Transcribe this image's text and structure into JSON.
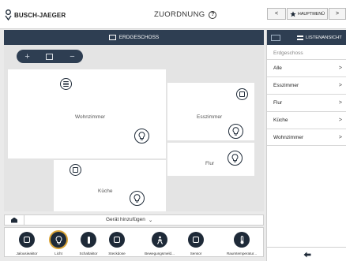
{
  "header": {
    "logo_text": "BUSCH-JAEGER",
    "title": "ZUORDNUNG",
    "help_symbol": "?",
    "nav_prev": "<",
    "nav_main": "HAUPTMENÜ",
    "nav_next": ">"
  },
  "floorplan": {
    "floor_name": "ERDGESCHOSS",
    "zoom_in": "+",
    "zoom_out": "−",
    "rooms": [
      {
        "name": "Wohnzimmer"
      },
      {
        "name": "Esszimmer"
      },
      {
        "name": "Flur"
      },
      {
        "name": "Küche"
      }
    ]
  },
  "right_panel": {
    "title": "LISTENANSICHT",
    "floor": "Erdgeschoss",
    "items": [
      {
        "label": "Alle",
        "chevron": ">"
      },
      {
        "label": "Esszimmer",
        "chevron": ">"
      },
      {
        "label": "Flur",
        "chevron": ">"
      },
      {
        "label": "Küche",
        "chevron": ">"
      },
      {
        "label": "Wohnzimmer",
        "chevron": ">"
      }
    ],
    "back_symbol": "🡸"
  },
  "add_bar": {
    "label": "Gerät hinzufügen",
    "chevron": "⌄"
  },
  "tray": {
    "tools": [
      {
        "label": "Jalousieaktor",
        "icon": "blind-actuator-icon"
      },
      {
        "label": "Licht",
        "icon": "light-bulb-icon",
        "active": true
      },
      {
        "label": "Schaltaktor",
        "icon": "switch-actuator-icon"
      },
      {
        "label": "Steckdose",
        "icon": "socket-icon"
      },
      {
        "label": "Bewegungsmeld...",
        "icon": "motion-sensor-icon"
      },
      {
        "label": "Sensor",
        "icon": "sensor-icon"
      },
      {
        "label": "Raumtemperatur...",
        "icon": "thermostat-icon"
      }
    ]
  },
  "colors": {
    "navy": "#2e3e52",
    "accent": "#d9a336"
  }
}
